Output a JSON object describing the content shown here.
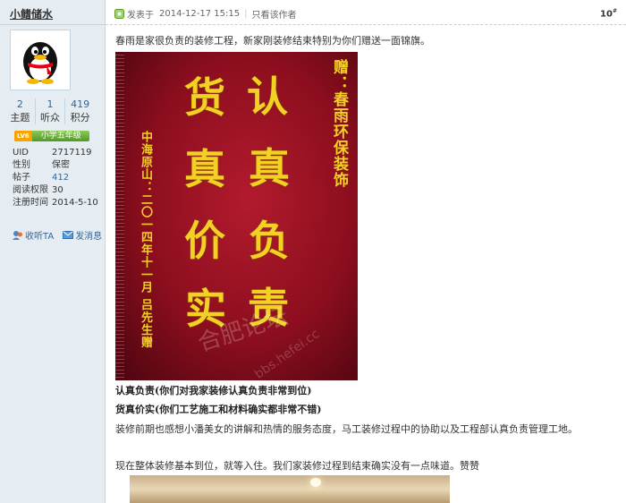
{
  "user": {
    "name": "小鳍储水",
    "stats": [
      {
        "value": "2",
        "label": "主题"
      },
      {
        "value": "1",
        "label": "听众"
      },
      {
        "value": "419",
        "label": "积分"
      }
    ],
    "level_badge": "LV6",
    "level_name": "小学五年级",
    "info": [
      {
        "key": "UID",
        "value": "2717119"
      },
      {
        "key": "性别",
        "value": "保密"
      },
      {
        "key": "帖子",
        "value": "412"
      },
      {
        "key": "阅读权限",
        "value": "30"
      },
      {
        "key": "注册时间",
        "value": "2014-5-10"
      }
    ],
    "actions": {
      "follow": "收听TA",
      "message": "发消息"
    }
  },
  "post": {
    "posted_label": "发表于",
    "posted_time": "2014-12-17 15:15",
    "author_only": "只看该作者",
    "floor": "10",
    "floor_suffix": "#",
    "intro": "春雨是家很负责的装修工程，新家刚装修结束特别为你们赠送一面锦旗。",
    "banner": {
      "chars_right": [
        "认",
        "真",
        "负",
        "责"
      ],
      "chars_left": [
        "货",
        "真",
        "价",
        "实"
      ],
      "gift_line": "赠：春雨环保装饰",
      "sign_line": "中海原山：二〇一四年十一月  吕先生赠",
      "watermark": "合肥论坛",
      "watermark_url": "bbs.hefei.cc"
    },
    "line1": "认真负责(你们对我家装修认真负责非常到位)",
    "line2": "货真价实(你们工艺施工和材料确实都非常不错)",
    "line3": "装修前期也感想小潘美女的讲解和热情的服务态度，马工装修过程中的协助以及工程部认真负责管理工地。",
    "line4": "现在整体装修基本到位，就等入住。我们家装修过程到结束确实没有一点味道。赞赞"
  },
  "colors": {
    "sidebar_bg": "#e5edf2",
    "link": "#336699",
    "banner_red": "#8c0e1e",
    "banner_gold": "#f2d024"
  }
}
